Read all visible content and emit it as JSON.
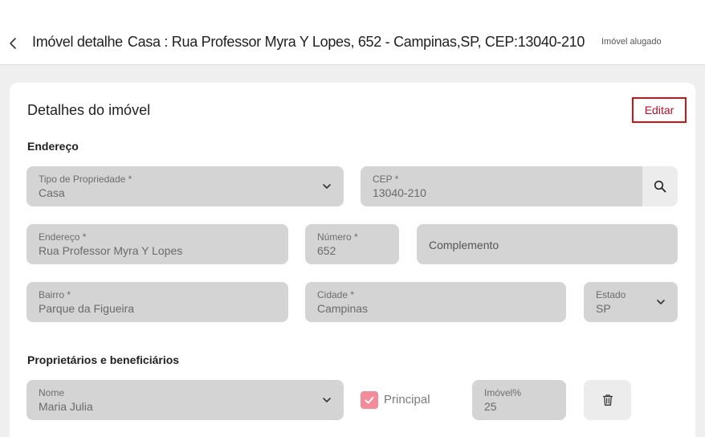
{
  "header": {
    "back_icon": "chevron-left-icon",
    "title_prefix": "Imóvel detalhe",
    "title_address": "Casa : Rua Professor Myra Y Lopes, 652 - Campinas,SP, CEP:13040-210",
    "status": "Imóvel alugado"
  },
  "card": {
    "title": "Detalhes do imóvel",
    "edit_label": "Editar"
  },
  "address": {
    "section_label": "Endereço",
    "property_type": {
      "label": "Tipo de Propriedade *",
      "value": "Casa"
    },
    "cep": {
      "label": "CEP *",
      "value": "13040-210"
    },
    "street": {
      "label": "Endereço *",
      "value": "Rua Professor Myra Y Lopes"
    },
    "number": {
      "label": "Número *",
      "value": "652"
    },
    "complement": {
      "placeholder": "Complemento"
    },
    "neighborhood": {
      "label": "Bairro *",
      "value": "Parque da Figueira"
    },
    "city": {
      "label": "Cidade *",
      "value": "Campinas"
    },
    "state": {
      "label": "Estado",
      "value": "SP"
    }
  },
  "owners": {
    "section_label": "Proprietários e beneficiários",
    "name": {
      "label": "Nome",
      "value": "Maria Julia"
    },
    "principal_label": "Principal",
    "principal_checked": true,
    "share": {
      "label": "Imóvel%",
      "value": "25"
    }
  },
  "colors": {
    "accent": "#d01414",
    "edit_text": "#b3122b",
    "checkbox": "#f28c9a",
    "field_bg": "#d4d4d4",
    "page_bg": "#efefef"
  }
}
